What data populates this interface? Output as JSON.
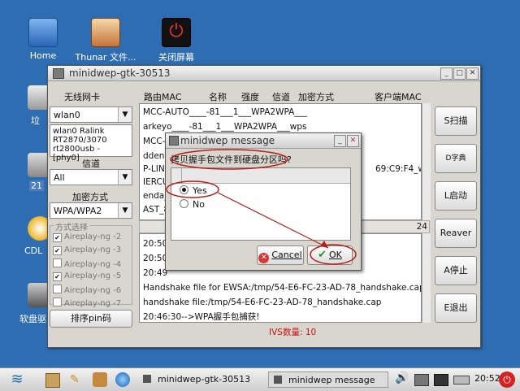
{
  "desktop": {
    "icons": [
      {
        "label": "Home"
      },
      {
        "label": "Thunar 文件..."
      },
      {
        "label": "关闭屏幕"
      }
    ],
    "side_labels": [
      "垃",
      "21",
      "CDL",
      "软盘驱"
    ]
  },
  "main_window": {
    "title": "minidwep-gtk-30513",
    "wireless_card_label": "无线网卡",
    "adapter": "wlan0",
    "adapter_info": [
      "wlan0 Ralink",
      "RT2870/3070",
      "rt2800usb - [phy0]"
    ],
    "channel_label": "信道",
    "channel_value": "All",
    "encryption_label": "加密方式",
    "encryption_value": "WPA/WPA2",
    "method_label": "方式选择",
    "methods": [
      {
        "label": "Aireplay-ng -2",
        "checked": true
      },
      {
        "label": "Aireplay-ng -3",
        "checked": true
      },
      {
        "label": "Aireplay-ng -4",
        "checked": false
      },
      {
        "label": "Aireplay-ng -5",
        "checked": true
      },
      {
        "label": "Aireplay-ng -6",
        "checked": false
      },
      {
        "label": "Aireplay-ng -7",
        "checked": false
      }
    ],
    "pin_button": "排序pin码",
    "columns": [
      "路由MAC",
      "名称",
      "强度",
      "信道",
      "加密方式",
      "客户端MAC"
    ],
    "ap_rows": [
      "MCC-AUTO____-81___1___WPA2WPA___",
      "arkeyo____-81___1___WPA2WPA___wps",
      "MCC-",
      "dden",
      "P-LINI",
      "IERCU",
      "enda_",
      "AST_8"
    ],
    "client_mac": "69:C9:F4_wps",
    "count_value": "24",
    "log_lines": [
      "20:50",
      "20:50",
      "20:49",
      "Handshake file for EWSA:/tmp/54-E6-FC-23-AD-78_handshake.cap.wkp",
      "handshake file:/tmp/54-E6-FC-23-AD-78_handshake.cap",
      "20:46:30-->WPA握手包捕获!"
    ],
    "ivs_status": "IVS数量: 10",
    "buttons": {
      "scan": "S扫描",
      "dict": "D字典",
      "start": "L启动",
      "reaver": "Reaver",
      "stop": "A停止",
      "exit": "E退出"
    }
  },
  "dialog": {
    "title": "minidwep message",
    "question": "拷贝握手包文件到硬盘分区吗?",
    "options": [
      {
        "label": "Yes",
        "selected": true
      },
      {
        "label": "No",
        "selected": false
      }
    ],
    "cancel_label": "Cancel",
    "ok_label": "OK"
  },
  "taskbar": {
    "tasks": [
      "minidwep-gtk-30513",
      "minidwep message"
    ],
    "clock": "20:52"
  },
  "colors": {
    "desktop": "#2f6db2",
    "annotation": "#b3201c",
    "ivs_text": "#cc1111",
    "cancel_icon": "#d23a3a",
    "ok_icon": "#2f8f2f"
  }
}
